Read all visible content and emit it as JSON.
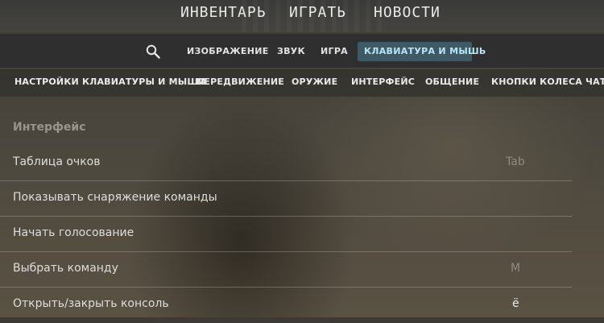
{
  "top_nav": {
    "tabs": [
      "ИНВЕНТАРЬ",
      "ИГРАТЬ",
      "НОВОСТИ"
    ]
  },
  "settings_tabs": {
    "search_icon": "search-icon",
    "tabs": [
      "ИЗОБРАЖЕНИЕ",
      "ЗВУК",
      "ИГРА",
      "КЛАВИАТУРА И МЫШЬ"
    ],
    "active": "КЛАВИАТУРА И МЫШЬ"
  },
  "categories": [
    "НАСТРОЙКИ КЛАВИАТУРЫ И МЫШИ",
    "ПЕРЕДВИЖЕНИЕ",
    "ОРУЖИЕ",
    "ИНТЕРФЕЙС",
    "ОБЩЕНИЕ",
    "КНОПКИ КОЛЕСА ЧАТА"
  ],
  "section": {
    "title": "Интерфейс",
    "rows": [
      {
        "label": "Таблица очков",
        "key": "Tab"
      },
      {
        "label": "Показывать снаряжение команды",
        "key": ""
      },
      {
        "label": "Начать голосование",
        "key": ""
      },
      {
        "label": "Выбрать команду",
        "key": "M"
      },
      {
        "label": "Открыть/закрыть консоль",
        "key": "ё"
      }
    ]
  },
  "colors": {
    "active_tab_bg": "#3e5a66",
    "active_tab_text": "#b9e4f5"
  }
}
